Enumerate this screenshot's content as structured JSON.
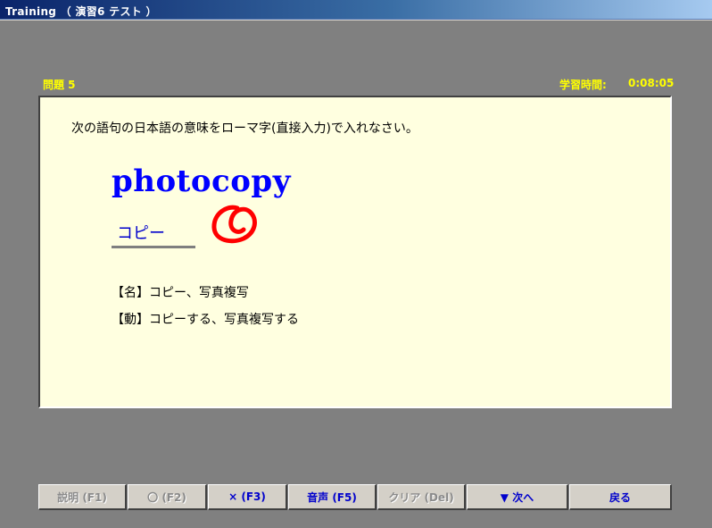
{
  "window": {
    "title": "Training （ 演習6  テスト ）"
  },
  "question": {
    "label": "問題  5",
    "time_label": "学習時間:",
    "time_value": "0:08:05"
  },
  "content": {
    "instruction": "次の語句の日本語の意味をローマ字(直接入力)で入れなさい。",
    "word": "photocopy",
    "answer": "コピー",
    "result_mark": "correct-circle",
    "meanings": [
      "【名】コピー、写真複写",
      "【動】コピーする、写真複写する"
    ]
  },
  "buttons": [
    {
      "label": "説明 (F1)",
      "enabled": false
    },
    {
      "label": "〇 (F2)",
      "enabled": false
    },
    {
      "label": "× (F3)",
      "enabled": true
    },
    {
      "label": "音声 (F5)",
      "enabled": true
    },
    {
      "label": "クリア (Del)",
      "enabled": false
    },
    {
      "label": "▼ 次へ",
      "enabled": true
    },
    {
      "label": "戻る",
      "enabled": true
    }
  ],
  "colors": {
    "accent_text": "#0000ff",
    "label_yellow": "#ffff00",
    "panel_bg": "#ffffe0",
    "mark_red": "#ff0000"
  }
}
